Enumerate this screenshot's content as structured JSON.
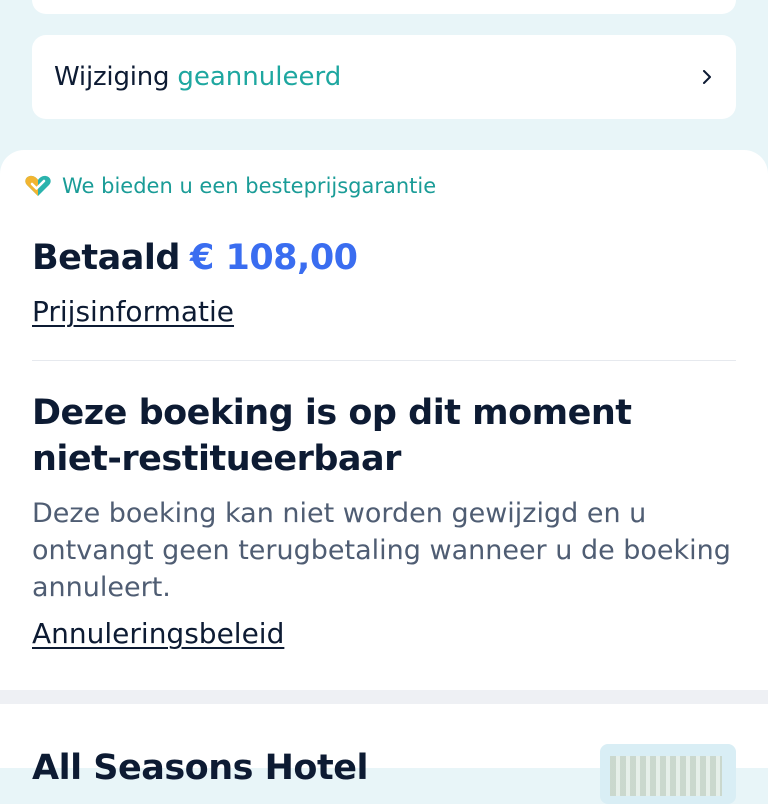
{
  "modification": {
    "label": "Wijziging",
    "status": "geannuleerd"
  },
  "payment": {
    "guarantee_text": "We bieden u een besteprijsgarantie",
    "paid_label": "Betaald",
    "paid_amount": "€ 108,00",
    "price_info_link": "Prijsinformatie"
  },
  "refund": {
    "title": "Deze boeking is op dit moment niet-restitueerbaar",
    "description": "Deze boeking kan niet worden gewijzigd en u ontvangt geen terugbetaling wanneer u de boeking annuleert.",
    "policy_link": "Annuleringsbeleid"
  },
  "hotel": {
    "name": "All Seasons Hotel"
  },
  "colors": {
    "accent_teal": "#1ea7a0",
    "price_blue": "#3a6df0",
    "text_dark": "#0d1b33",
    "background": "#e8f5f8"
  }
}
